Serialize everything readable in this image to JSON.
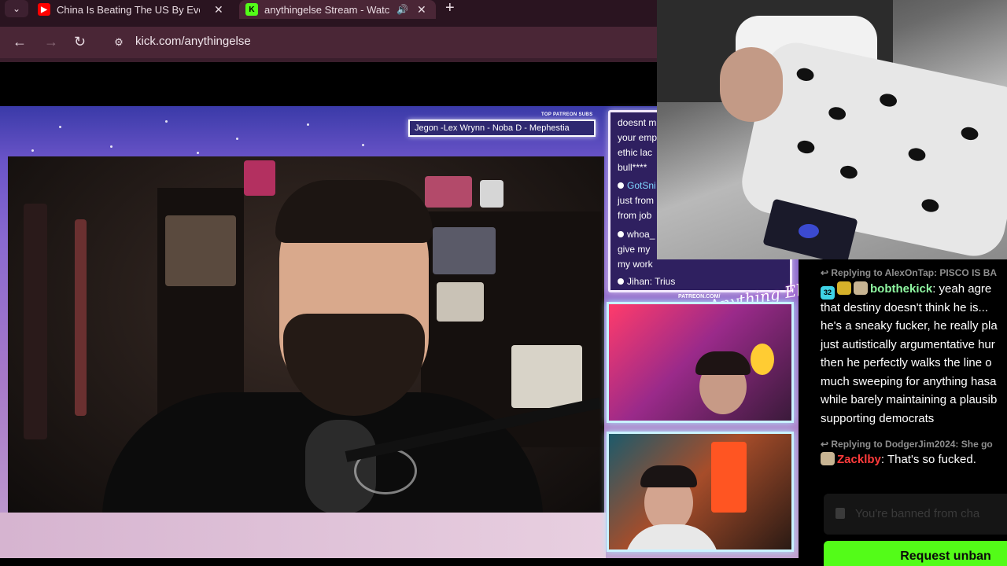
{
  "browser": {
    "tabs": [
      {
        "title": "China Is Beating The US By Ever",
        "favicon": "youtube-icon",
        "color": "#ff0000",
        "active": false
      },
      {
        "title": "anythingelse Stream - Watc",
        "favicon": "kick-icon",
        "color": "#53fc18",
        "active": true
      }
    ],
    "url": "kick.com/anythingelse"
  },
  "stream": {
    "patreon_header": "TOP PATREON SUBS",
    "patreon_names": "Jegon -Lex Wrynn -  Noba D - Mephestia",
    "patreon_url": "PATREON.COM/",
    "logo_text": "Anything Else",
    "overlay_chat": [
      {
        "text": "doesnt m"
      },
      {
        "text": "your emp"
      },
      {
        "text": "ethic lac"
      },
      {
        "text": "bull****"
      },
      {
        "user": "GotSni"
      },
      {
        "text": "just from"
      },
      {
        "text": "from job"
      },
      {
        "user": "whoa_"
      },
      {
        "text": "give my"
      },
      {
        "text": "my work"
      },
      {
        "user": "Jihan: Trius"
      }
    ]
  },
  "chat": {
    "messages": [
      {
        "reply_to": "Replying to AlexOnTap: PISCO IS BA",
        "badge_count": "32",
        "username": "bobthekick",
        "username_color": "#8ef5a0",
        "lines": [
          "yeah agre",
          "that destiny doesn't think he is...",
          "he's a sneaky fucker, he really pla",
          "just autistically argumentative hur",
          "then he perfectly walks the line o",
          "much sweeping for anything hasa",
          "while barely maintaining a plausib",
          "supporting democrats"
        ]
      },
      {
        "reply_to": "Replying to DodgerJim2024: She go",
        "username": "Zacklby",
        "username_color": "#ff3b3b",
        "lines": [
          "That's so fucked."
        ]
      }
    ],
    "input_placeholder": "You're banned from cha",
    "unban_label": "Request unban"
  }
}
